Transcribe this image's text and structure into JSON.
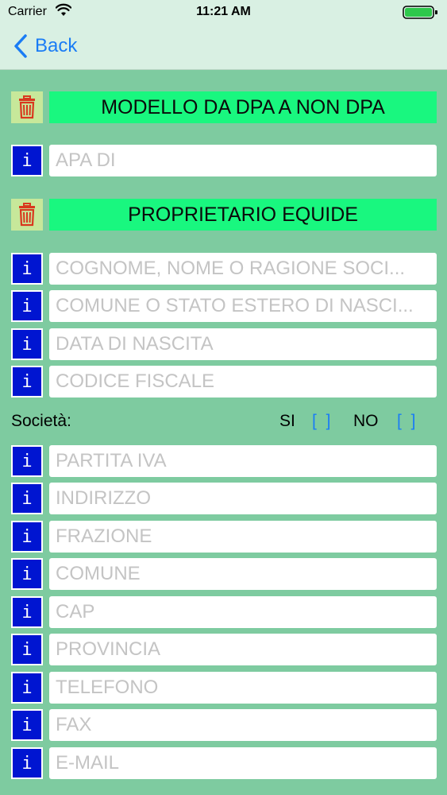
{
  "status_bar": {
    "carrier": "Carrier",
    "time": "11:21 AM"
  },
  "nav": {
    "back_label": "Back"
  },
  "section1": {
    "title": "MODELLO DA DPA A NON DPA"
  },
  "apa_field": {
    "placeholder": "APA DI",
    "value": ""
  },
  "section2": {
    "title": "PROPRIETARIO EQUIDE"
  },
  "owner_fields": [
    {
      "placeholder": "COGNOME, NOME O RAGIONE SOCI...",
      "value": ""
    },
    {
      "placeholder": "COMUNE O STATO ESTERO DI NASCI...",
      "value": ""
    },
    {
      "placeholder": "DATA DI NASCITA",
      "value": ""
    },
    {
      "placeholder": "CODICE FISCALE",
      "value": ""
    }
  ],
  "societa": {
    "label": "Società:",
    "si_label": "SI",
    "si_box": "[ ]",
    "no_label": "NO",
    "no_box": "[ ]"
  },
  "company_fields": [
    {
      "placeholder": "PARTITA IVA",
      "value": ""
    },
    {
      "placeholder": "INDIRIZZO",
      "value": ""
    },
    {
      "placeholder": "FRAZIONE",
      "value": ""
    },
    {
      "placeholder": "COMUNE",
      "value": ""
    },
    {
      "placeholder": "CAP",
      "value": ""
    },
    {
      "placeholder": "PROVINCIA",
      "value": ""
    },
    {
      "placeholder": "TELEFONO",
      "value": ""
    },
    {
      "placeholder": "FAX",
      "value": ""
    },
    {
      "placeholder": "E-MAIL",
      "value": ""
    }
  ],
  "info_button_label": "i",
  "colors": {
    "background": "#7ecba0",
    "nav_background": "#d9f0e3",
    "header_green": "#19f77f",
    "trash_button_bg": "#c7e89a",
    "info_button_bg": "#0015d1",
    "link_blue": "#1a7cf5",
    "trash_red": "#d9381e"
  },
  "icons": {
    "back": "chevron-left-icon",
    "trash": "trash-icon",
    "wifi": "wifi-icon",
    "battery": "battery-icon"
  }
}
